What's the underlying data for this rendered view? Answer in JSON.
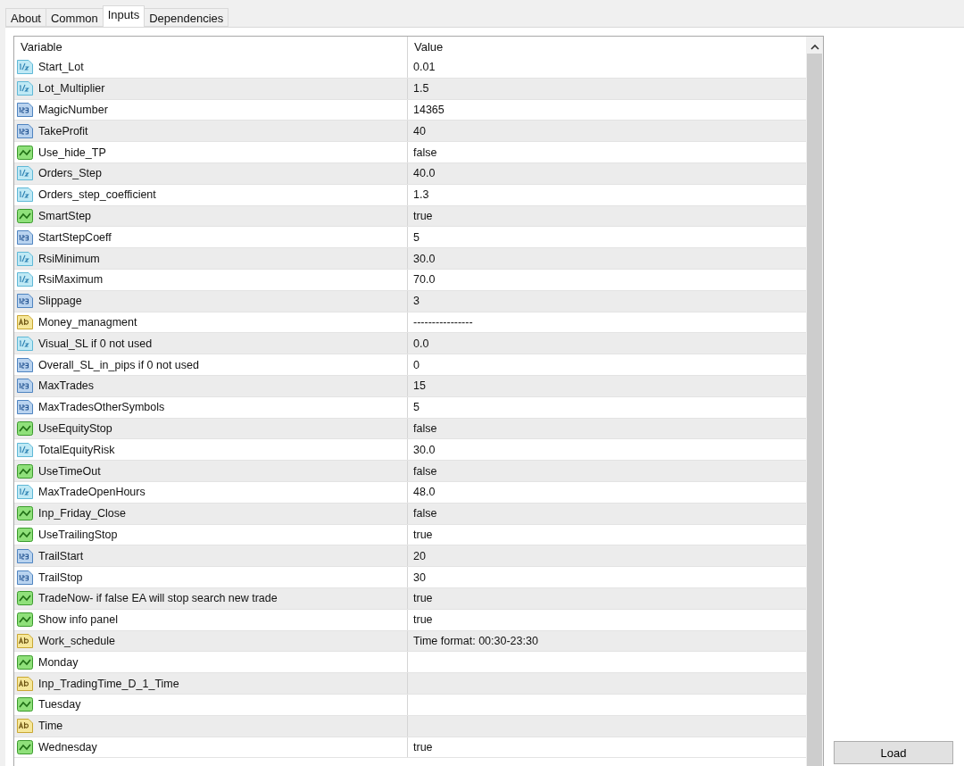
{
  "tabs": [
    {
      "label": "About",
      "selected": false
    },
    {
      "label": "Common",
      "selected": false
    },
    {
      "label": "Inputs",
      "selected": true
    },
    {
      "label": "Dependencies",
      "selected": false
    }
  ],
  "table": {
    "columns": [
      "Variable",
      "Value"
    ],
    "rows": [
      {
        "kind": "double",
        "name": "Start_Lot",
        "value": "0.01"
      },
      {
        "kind": "double",
        "name": "Lot_Multiplier",
        "value": "1.5"
      },
      {
        "kind": "int",
        "name": "MagicNumber",
        "value": "14365"
      },
      {
        "kind": "int",
        "name": "TakeProfit",
        "value": "40"
      },
      {
        "kind": "bool",
        "name": "Use_hide_TP",
        "value": "false"
      },
      {
        "kind": "double",
        "name": "Orders_Step",
        "value": "40.0"
      },
      {
        "kind": "double",
        "name": "Orders_step_coefficient",
        "value": "1.3"
      },
      {
        "kind": "bool",
        "name": "SmartStep",
        "value": "true"
      },
      {
        "kind": "int",
        "name": "StartStepCoeff",
        "value": "5"
      },
      {
        "kind": "double",
        "name": "RsiMinimum",
        "value": "30.0"
      },
      {
        "kind": "double",
        "name": "RsiMaximum",
        "value": "70.0"
      },
      {
        "kind": "int",
        "name": "Slippage",
        "value": "3"
      },
      {
        "kind": "string",
        "name": "Money_managment",
        "value": "----------------"
      },
      {
        "kind": "double",
        "name": "Visual_SL if 0 not used",
        "value": "0.0"
      },
      {
        "kind": "int",
        "name": "Overall_SL_in_pips if 0 not used",
        "value": "0"
      },
      {
        "kind": "int",
        "name": "MaxTrades",
        "value": "15"
      },
      {
        "kind": "int",
        "name": "MaxTradesOtherSymbols",
        "value": "5"
      },
      {
        "kind": "bool",
        "name": "UseEquityStop",
        "value": "false"
      },
      {
        "kind": "double",
        "name": "TotalEquityRisk",
        "value": "30.0"
      },
      {
        "kind": "bool",
        "name": "UseTimeOut",
        "value": "false"
      },
      {
        "kind": "double",
        "name": "MaxTradeOpenHours",
        "value": "48.0"
      },
      {
        "kind": "bool",
        "name": "Inp_Friday_Close",
        "value": "false"
      },
      {
        "kind": "bool",
        "name": "UseTrailingStop",
        "value": "true"
      },
      {
        "kind": "int",
        "name": "TrailStart",
        "value": "20"
      },
      {
        "kind": "int",
        "name": "TrailStop",
        "value": "30"
      },
      {
        "kind": "bool",
        "name": "TradeNow- if false EA will stop search new trade",
        "value": "true"
      },
      {
        "kind": "bool",
        "name": "Show info panel",
        "value": "true"
      },
      {
        "kind": "string",
        "name": "Work_schedule",
        "value": "Time format: 00:30-23:30"
      },
      {
        "kind": "bool",
        "name": "Monday"
      },
      {
        "kind": "string",
        "name": "Inp_TradingTime_D_1_Time"
      },
      {
        "kind": "bool",
        "name": "Tuesday"
      },
      {
        "kind": "string",
        "name": "Time"
      },
      {
        "kind": "bool",
        "name": "Wednesday",
        "value": "true"
      }
    ]
  },
  "buttons": [
    {
      "label": "Load"
    }
  ]
}
